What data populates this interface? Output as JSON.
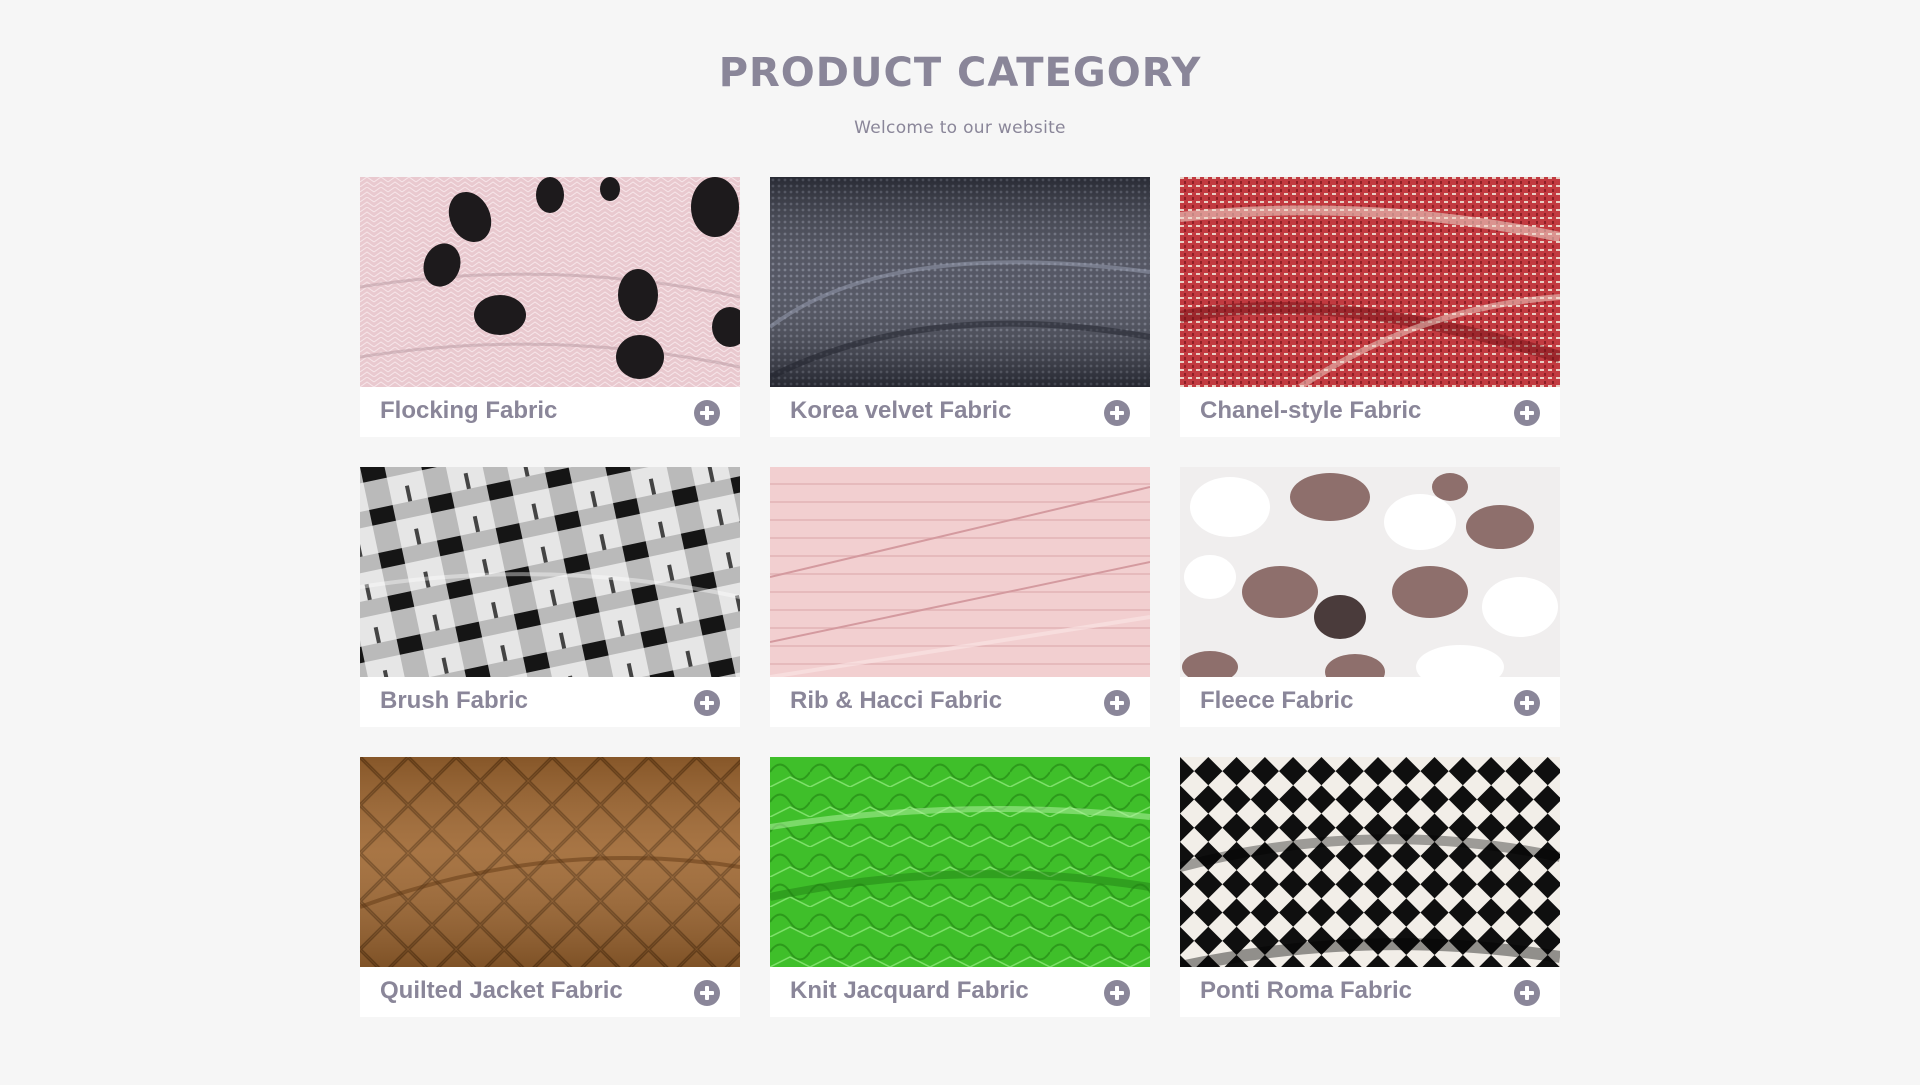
{
  "header": {
    "title": "PRODUCT CATEGORY",
    "subtitle": "Welcome to our website"
  },
  "colors": {
    "text": "#8a8699",
    "background": "#f6f6f6",
    "card": "#ffffff"
  },
  "categories": [
    {
      "label": "Flocking Fabric",
      "icon": "plus-circle-icon"
    },
    {
      "label": "Korea velvet Fabric",
      "icon": "plus-circle-icon"
    },
    {
      "label": "Chanel-style Fabric",
      "icon": "plus-circle-icon"
    },
    {
      "label": "Brush Fabric",
      "icon": "plus-circle-icon"
    },
    {
      "label": "Rib & Hacci Fabric",
      "icon": "plus-circle-icon"
    },
    {
      "label": "Fleece Fabric",
      "icon": "plus-circle-icon"
    },
    {
      "label": "Quilted Jacket Fabric",
      "icon": "plus-circle-icon"
    },
    {
      "label": "Knit Jacquard Fabric",
      "icon": "plus-circle-icon"
    },
    {
      "label": "Ponti Roma Fabric",
      "icon": "plus-circle-icon"
    }
  ]
}
